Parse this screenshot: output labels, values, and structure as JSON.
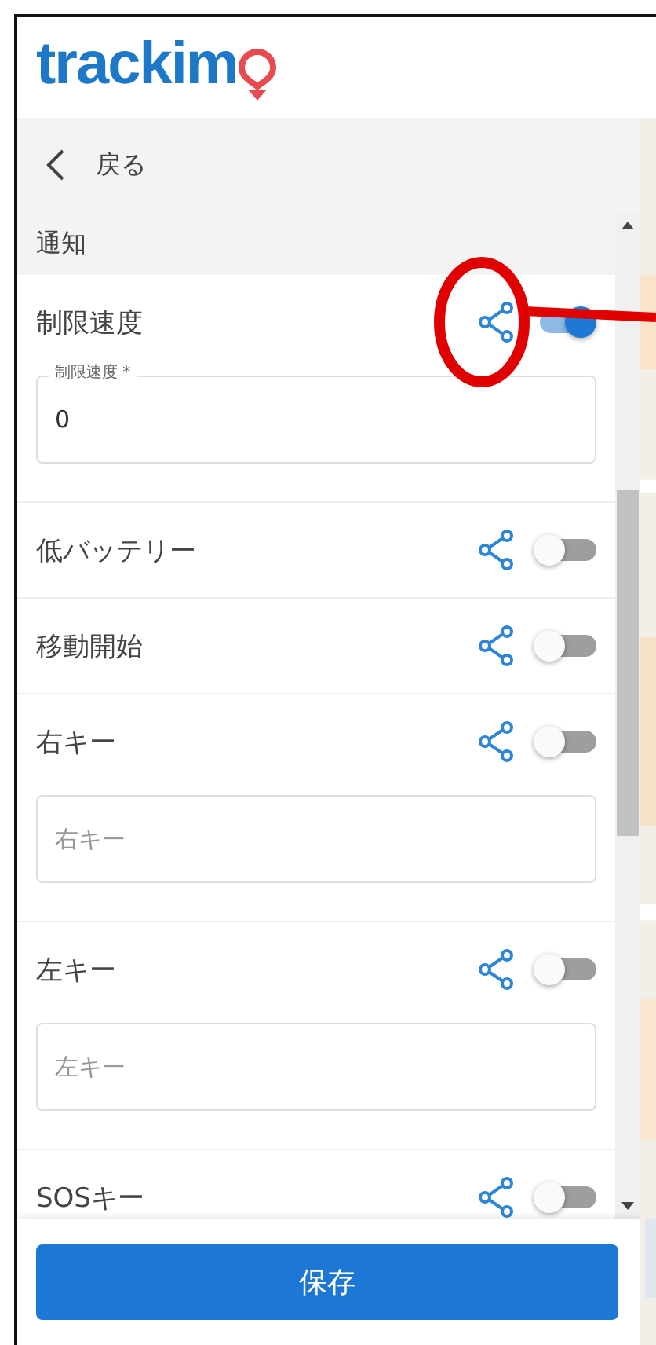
{
  "logo": {
    "text": "trackim"
  },
  "nav": {
    "back_label": "戻る"
  },
  "section": {
    "title": "通知"
  },
  "notifications": [
    {
      "label": "制限速度",
      "on": true,
      "field": {
        "label": "制限速度 *",
        "value": "0"
      }
    },
    {
      "label": "低バッテリー",
      "on": false
    },
    {
      "label": "移動開始",
      "on": false
    },
    {
      "label": "右キー",
      "on": false,
      "field": {
        "placeholder": "右キー"
      }
    },
    {
      "label": "左キー",
      "on": false,
      "field": {
        "placeholder": "左キー"
      }
    },
    {
      "label": "SOSキー",
      "on": false
    }
  ],
  "save_button": {
    "label": "保存"
  }
}
